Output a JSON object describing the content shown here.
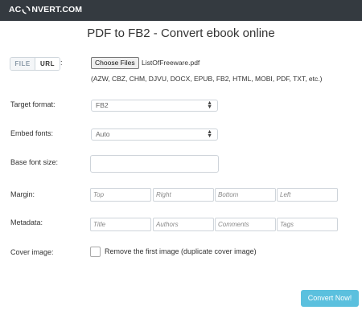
{
  "header": {
    "logo_part1": "AC",
    "logo_part2": "NVERT.COM"
  },
  "page": {
    "title": "PDF to FB2 - Convert ebook online"
  },
  "source": {
    "file_tab": "FILE",
    "url_tab": "URL",
    "colon": ":",
    "choose_button": "Choose Files",
    "file_name": "ListOfFreeware.pdf",
    "supported_formats": "(AZW, CBZ, CHM, DJVU, DOCX, EPUB, FB2, HTML, MOBI, PDF, TXT, etc.)"
  },
  "form": {
    "target_format_label": "Target format:",
    "target_format_value": "FB2",
    "embed_fonts_label": "Embed fonts:",
    "embed_fonts_value": "Auto",
    "base_font_size_label": "Base font size:",
    "margin_label": "Margin:",
    "margin_placeholders": {
      "top": "Top",
      "right": "Right",
      "bottom": "Bottom",
      "left": "Left"
    },
    "metadata_label": "Metadata:",
    "metadata_placeholders": {
      "title": "Title",
      "authors": "Authors",
      "comments": "Comments",
      "tags": "Tags"
    },
    "cover_image_label": "Cover image:",
    "cover_checkbox_label": "Remove the first image (duplicate cover image)"
  },
  "actions": {
    "convert_button": "Convert Now!"
  },
  "colors": {
    "topbar": "#343a40",
    "convert_button": "#5bc0de"
  }
}
